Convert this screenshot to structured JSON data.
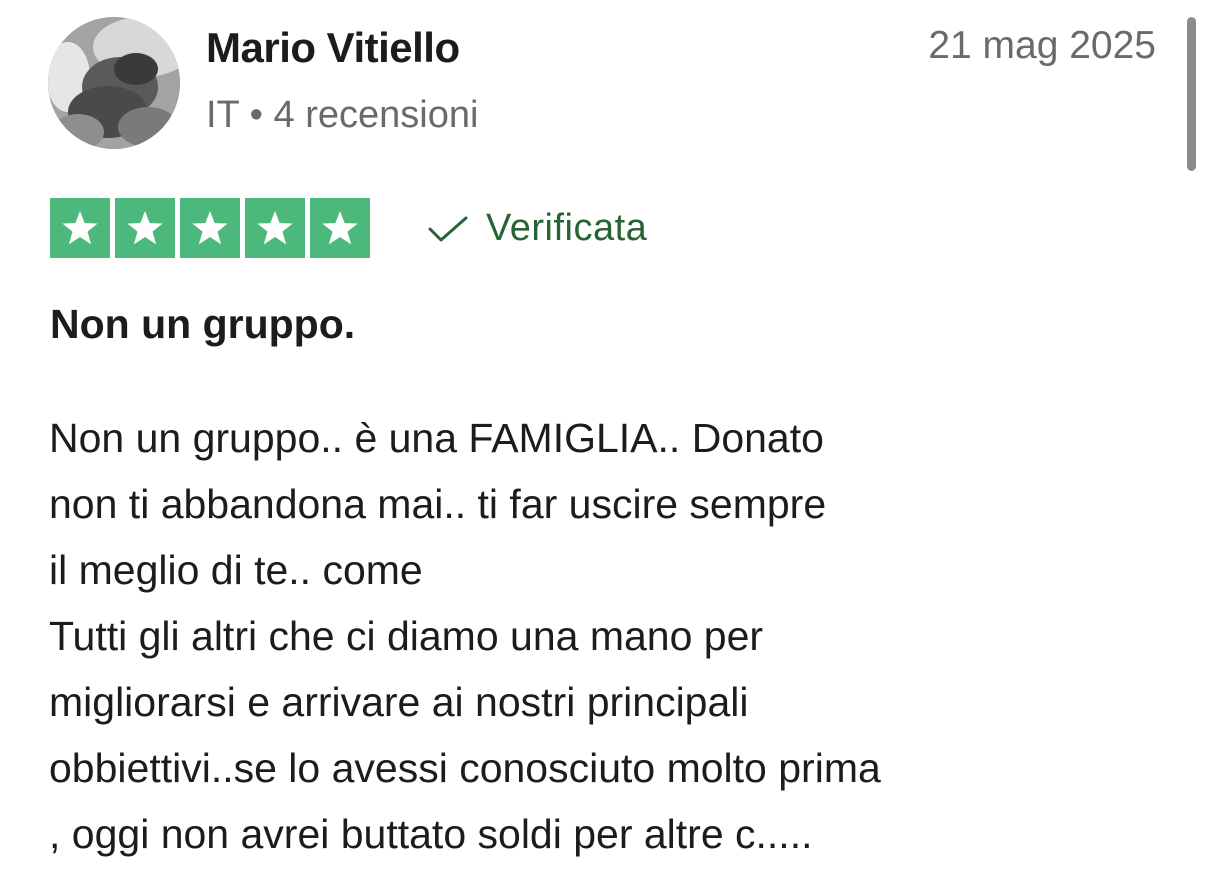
{
  "reviewer": {
    "name": "Mario Vitiello",
    "meta": "IT • 4 recensioni"
  },
  "review": {
    "date": "21 mag 2025",
    "rating": 5,
    "rating_max": 5,
    "verified_label": "Verificata",
    "title": "Non un gruppo.",
    "body_lines": [
      "Non un gruppo.. è una FAMIGLIA.. Donato",
      "non ti abbandona mai.. ti far uscire sempre",
      "il meglio di te.. come",
      "Tutti gli altri che ci diamo una mano per",
      "migliorarsi e arrivare ai nostri principali",
      "obbiettivi..se lo avessi conosciuto molto prima",
      ", oggi non avrei buttato soldi per altre c....."
    ]
  },
  "icons": {
    "star": "star-icon",
    "verified": "checkmark-icon",
    "avatar": "user-photo"
  },
  "colors": {
    "star_green": "#4cb87b",
    "verified_green": "#266335",
    "muted_text": "#6a6a6a",
    "text": "#1c1c1c"
  }
}
